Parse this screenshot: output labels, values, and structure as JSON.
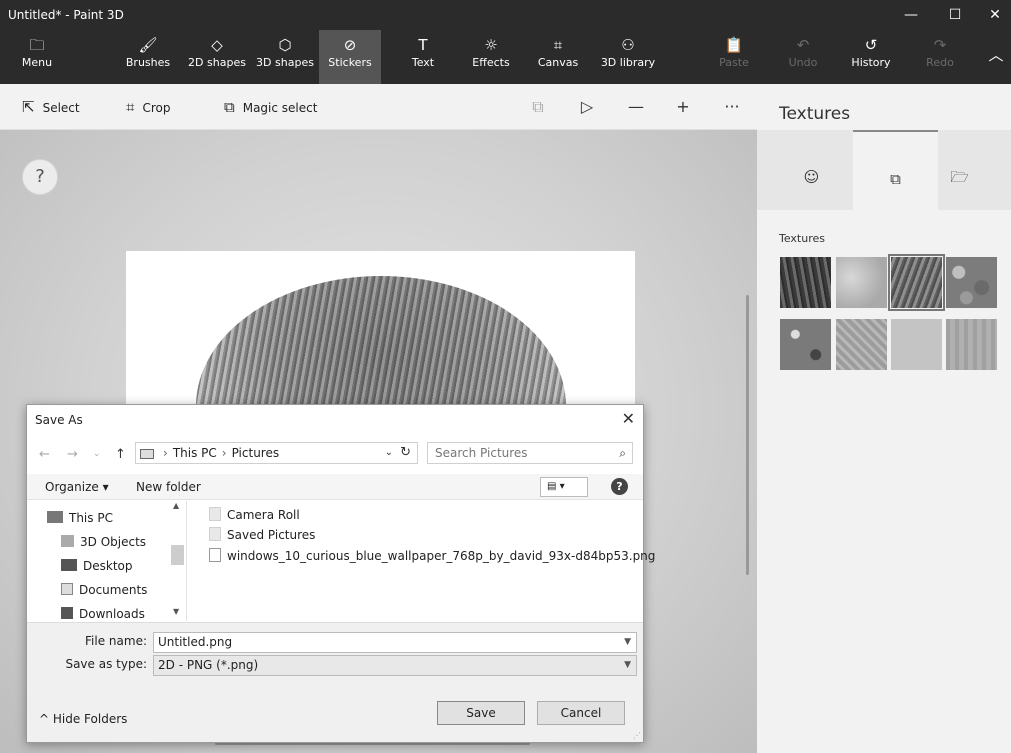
{
  "window": {
    "title": "Untitled* - Paint 3D",
    "controls": [
      "—",
      "☐",
      "✕"
    ]
  },
  "ribbon": {
    "menu": {
      "label": "Menu",
      "icon": "folder-icon"
    },
    "tools": [
      {
        "label": "Brushes",
        "glyph": "🖌"
      },
      {
        "label": "2D shapes",
        "glyph": "◇"
      },
      {
        "label": "3D shapes",
        "glyph": "⬡"
      },
      {
        "label": "Stickers",
        "glyph": "⊘"
      },
      {
        "label": "Text",
        "glyph": "T"
      },
      {
        "label": "Effects",
        "glyph": "☼"
      },
      {
        "label": "Canvas",
        "glyph": "⌗"
      },
      {
        "label": "3D library",
        "glyph": "⚇"
      },
      {
        "label": "Paste",
        "glyph": "📋"
      },
      {
        "label": "Undo",
        "glyph": "↶"
      },
      {
        "label": "History",
        "glyph": "↺"
      },
      {
        "label": "Redo",
        "glyph": "↷"
      }
    ],
    "active_tool": "Stickers",
    "collapse_glyph": "︿"
  },
  "toolbar": {
    "select": "Select",
    "crop": "Crop",
    "magic_select": "Magic select",
    "icons": [
      "⧉",
      "▷",
      "—",
      "+",
      "···"
    ]
  },
  "canvas": {
    "help_glyph": "?"
  },
  "panel": {
    "title": "Textures",
    "section_label": "Textures",
    "tabs": [
      "☺",
      "⧉",
      "🗁"
    ],
    "active_tab": 1,
    "swatches": [
      {
        "name": "bark",
        "color": "#4a4a4a"
      },
      {
        "name": "stone",
        "color": "#bcbcbc"
      },
      {
        "name": "hair",
        "color": "#6e6e6e"
      },
      {
        "name": "pebbles",
        "color": "#8c8c8c"
      },
      {
        "name": "gravel",
        "color": "#7a7a7a"
      },
      {
        "name": "cracked-stone",
        "color": "#a8a8a8"
      },
      {
        "name": "concrete",
        "color": "#c4c4c4"
      },
      {
        "name": "wood",
        "color": "#a6a6a6"
      }
    ],
    "selected_swatch": 2
  },
  "dialog": {
    "title": "Save As",
    "close": "✕",
    "nav": {
      "back": "←",
      "forward": "→",
      "up": "↑",
      "recent": "⌄"
    },
    "address": {
      "this_pc": "This PC",
      "pictures": "Pictures",
      "drop": "⌄",
      "refresh": "↻"
    },
    "search_placeholder": "Search Pictures",
    "search_glyph": "⌕",
    "commands": {
      "organize": "Organize ▾",
      "new_folder": "New folder",
      "help": "?"
    },
    "view_glyph": "▤ ▾",
    "nav_items": [
      {
        "label": "This PC"
      },
      {
        "label": "3D Objects"
      },
      {
        "label": "Desktop"
      },
      {
        "label": "Documents"
      },
      {
        "label": "Downloads"
      }
    ],
    "files": [
      {
        "name": "Camera Roll",
        "kind": "folder"
      },
      {
        "name": "Saved Pictures",
        "kind": "folder"
      },
      {
        "name": "windows_10_curious_blue_wallpaper_768p_by_david_93x-d84bp53.png",
        "kind": "file"
      }
    ],
    "file_name_label": "File name:",
    "file_name_value": "Untitled.png",
    "save_type_label": "Save as type:",
    "save_type_value": "2D - PNG (*.png)",
    "hide_folders": "Hide Folders",
    "save_button": "Save",
    "cancel_button": "Cancel"
  }
}
